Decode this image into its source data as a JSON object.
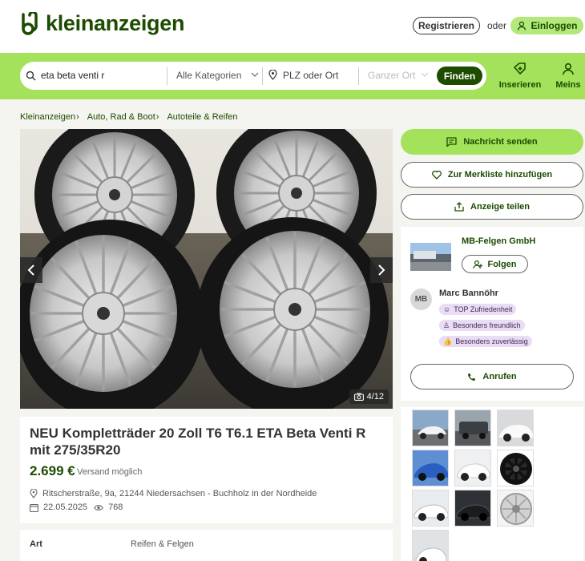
{
  "header": {
    "logo_text": "kleinanzeigen",
    "register_label": "Registrieren",
    "or_label": "oder",
    "login_label": "Einloggen"
  },
  "search": {
    "query": "eta beta venti r",
    "category": "Alle Kategorien",
    "location_placeholder": "PLZ oder Ort",
    "radius": "Ganzer Ort",
    "find_label": "Finden"
  },
  "nav": {
    "post_label": "Inserieren",
    "mine_label": "Meins"
  },
  "breadcrumb": [
    "Kleinanzeigen",
    "Auto, Rad & Boot",
    "Autoteile & Reifen"
  ],
  "gallery": {
    "counter": "4/12"
  },
  "ad": {
    "title": "NEU Kompletträder 20 Zoll T6 T6.1 ETA Beta Venti R mit 275/35R20",
    "price": "2.699 €",
    "shipping": "Versand möglich",
    "address": "Ritscherstraße, 9a, 21244 Niedersachsen - Buchholz in der Nordheide",
    "date": "22.05.2025",
    "views": "768"
  },
  "details": {
    "key": "Art",
    "value": "Reifen & Felgen"
  },
  "actions": {
    "message_label": "Nachricht senden",
    "watchlist_label": "Zur Merkliste hinzufügen",
    "share_label": "Anzeige teilen"
  },
  "seller": {
    "shop_name": "MB-Felgen GmbH",
    "follow_label": "Folgen",
    "initials": "MB",
    "person_name": "Marc Bannöhr",
    "badges": [
      "TOP Zufriedenheit",
      "Besonders freundlich",
      "Besonders zuverlässig"
    ],
    "call_label": "Anrufen"
  },
  "colors": {
    "brand_green": "#a3e25a",
    "brand_dark": "#1d4b00",
    "badge_bg": "#eadcf5"
  }
}
